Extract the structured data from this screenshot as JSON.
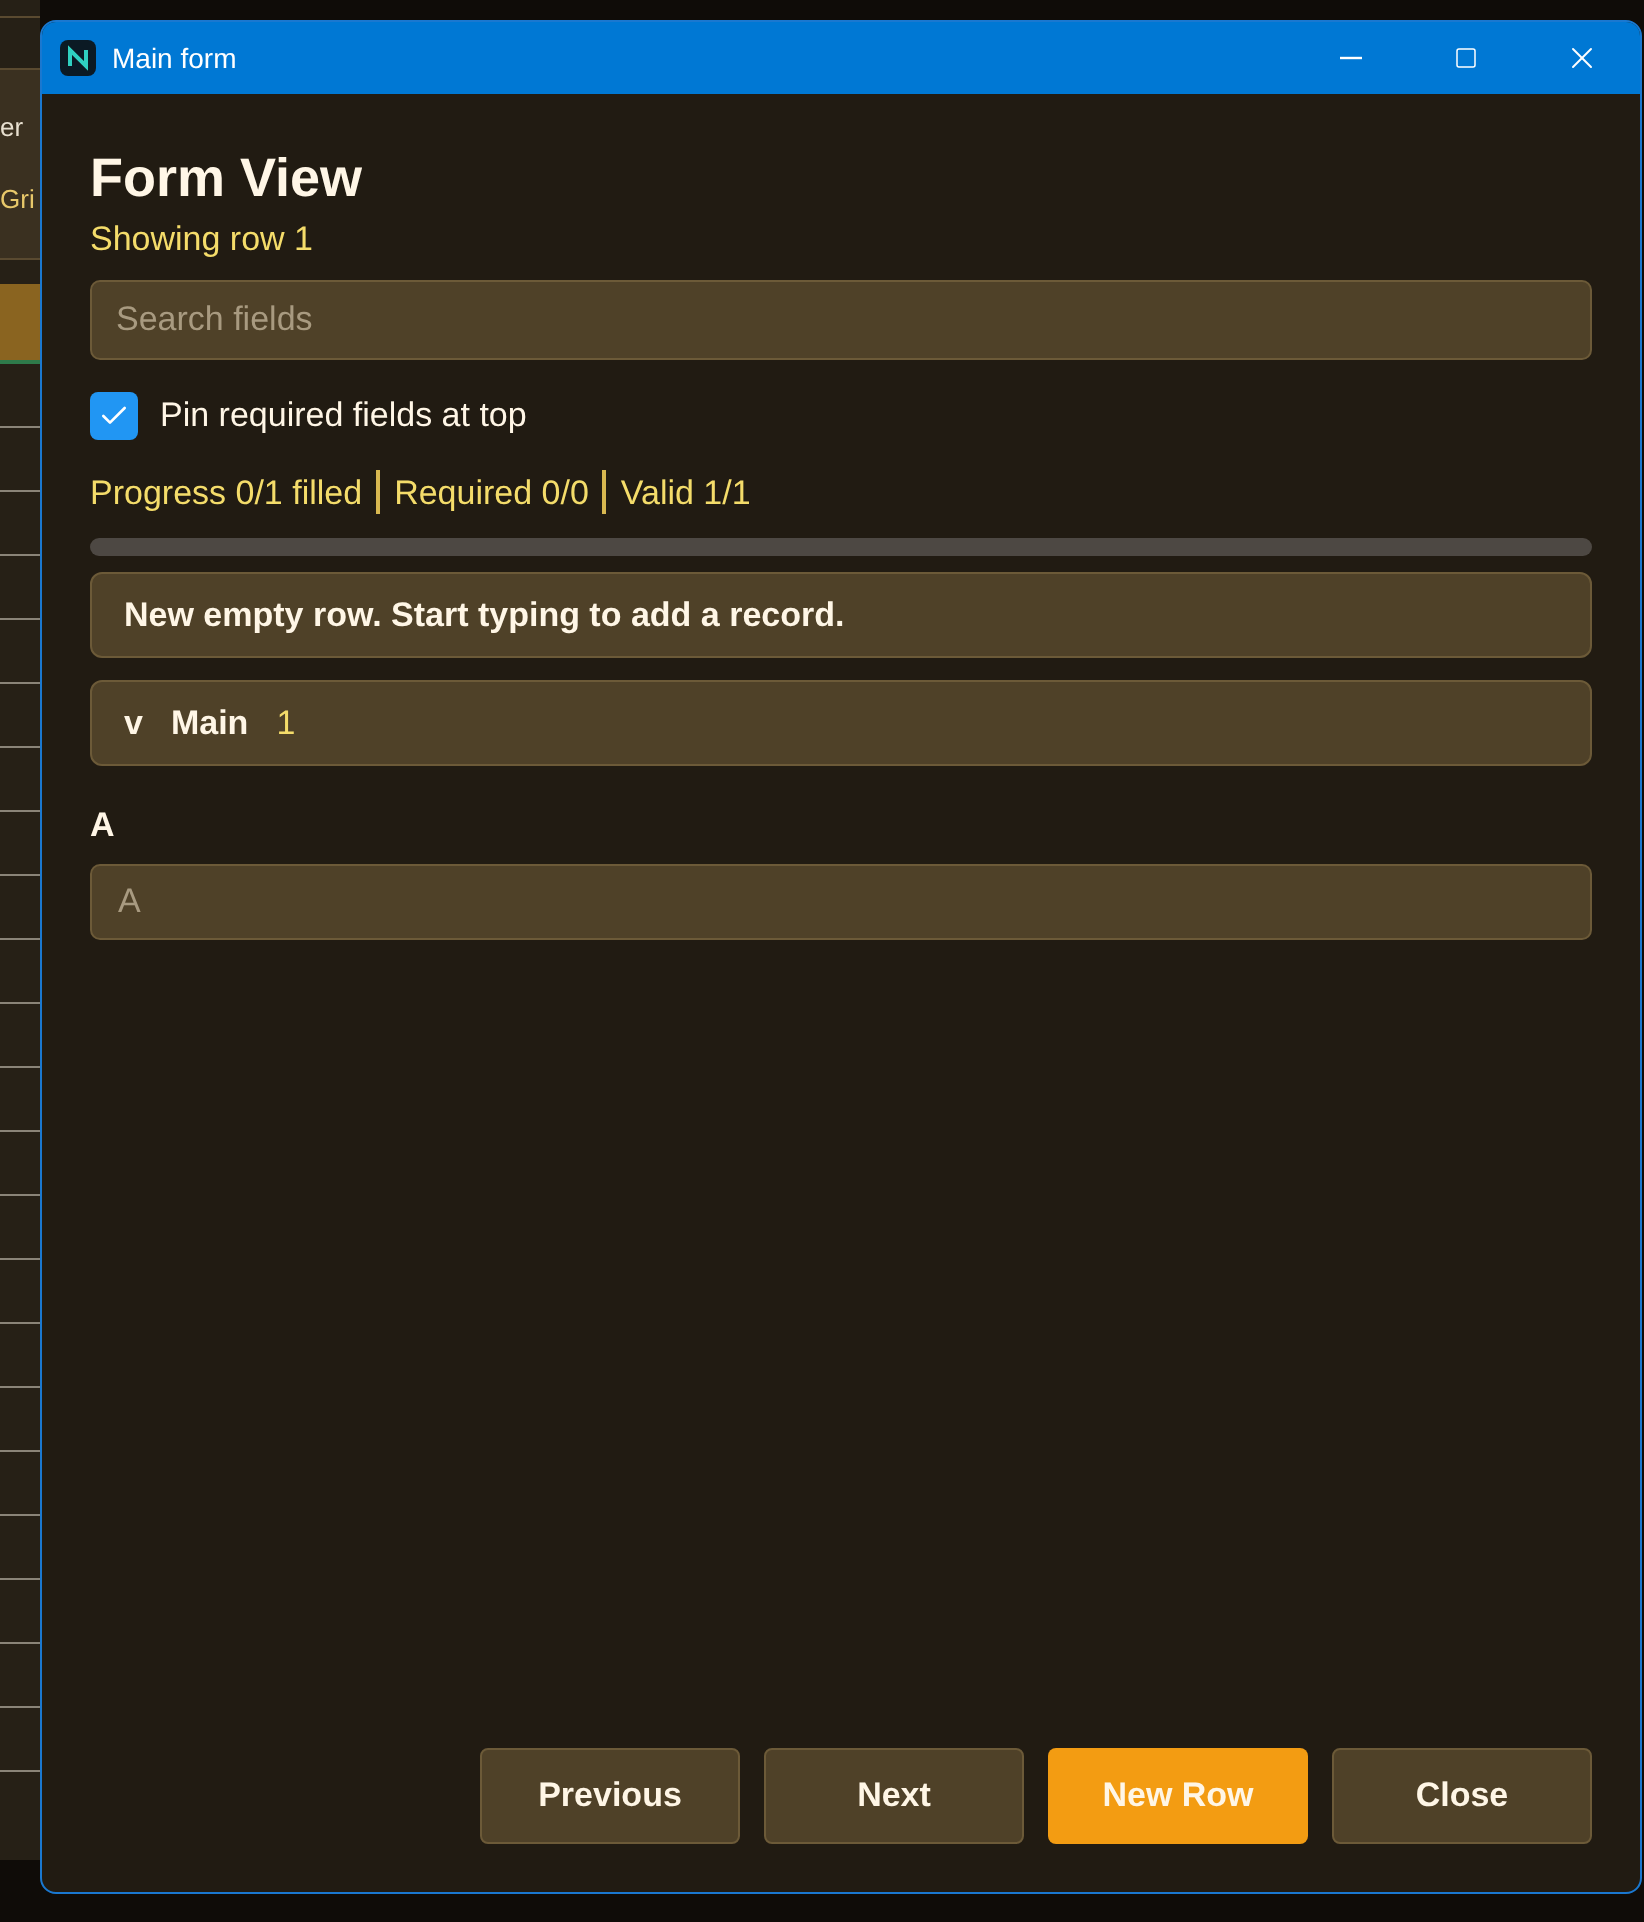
{
  "background_app": {
    "texts": [
      "er",
      "Gri"
    ]
  },
  "window": {
    "title": "Main form"
  },
  "form": {
    "heading": "Form View",
    "subtitle": "Showing row 1",
    "search": {
      "placeholder": "Search fields"
    },
    "pin_required": {
      "label": "Pin required fields at top",
      "checked": true
    },
    "stats": [
      "Progress 0/1 filled",
      "Required 0/0",
      "Valid 1/1"
    ],
    "progress": {
      "level": 0
    },
    "notice": "New empty row. Start typing to add a record.",
    "section": {
      "toggle": "v",
      "name": "Main",
      "count": "1",
      "expanded": true,
      "fields": [
        {
          "label": "A",
          "placeholder": "A"
        }
      ]
    }
  },
  "buttons": [
    {
      "label": "Previous",
      "kind": "normal"
    },
    {
      "label": "Next",
      "kind": "normal"
    },
    {
      "label": "New Row",
      "kind": "primary"
    },
    {
      "label": "Close",
      "kind": "normal"
    }
  ]
}
